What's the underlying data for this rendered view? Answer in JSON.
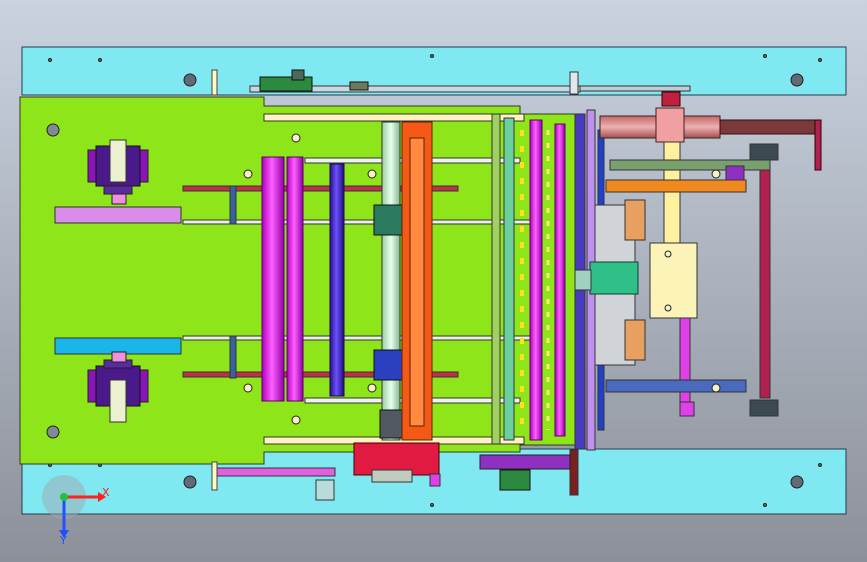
{
  "viewport": {
    "background_top": "#c9d3e0",
    "background_bottom": "#8c9099"
  },
  "colors": {
    "base_plate": "#7fe8f0",
    "main_plate": "#8ee51a",
    "roller_magenta": "#f019f5",
    "roller_blue": "#4a2bd8",
    "bar_orange": "#f45a16",
    "bracket_purple": "#8a14b8",
    "block_yellow": "#fbf3b8",
    "pipe_brown": "#7a3a3a",
    "pipe_pink": "#e58e8e",
    "rod_red": "#c0203a",
    "block_light_purple": "#d98ce8",
    "block_light_blue": "#1ab6ea",
    "motor_green": "#2fc08a",
    "frame_grey": "#5a6a80"
  },
  "triad": {
    "x_label": "X",
    "y_label": "Y",
    "x_color": "#ff2020",
    "y_color": "#2050ff",
    "origin_color": "#20c040"
  }
}
